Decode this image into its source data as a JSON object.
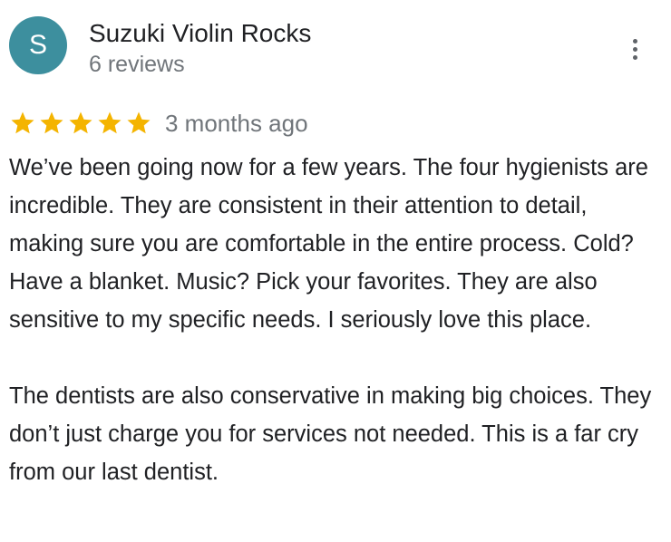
{
  "reviewer": {
    "avatar_letter": "S",
    "avatar_color": "#3d8f9e",
    "name": "Suzuki Violin Rocks",
    "review_count": "6 reviews"
  },
  "menu": {
    "icon": "more-vert-icon"
  },
  "review": {
    "rating": 5,
    "max_rating": 5,
    "star_color": "#f4b400",
    "date": "3 months ago",
    "paragraphs": [
      "We’ve been going now for a few years. The four hygienists are incredible. They are consistent in their attention to detail, making sure you are comfortable  in the entire process. Cold? Have a blanket. Music? Pick your favorites. They are also sensitive to my specific needs. I seriously love this place.",
      "The dentists are also conservative in making big choices. They don’t just charge you for services not needed. This is a far cry from our last dentist."
    ]
  }
}
